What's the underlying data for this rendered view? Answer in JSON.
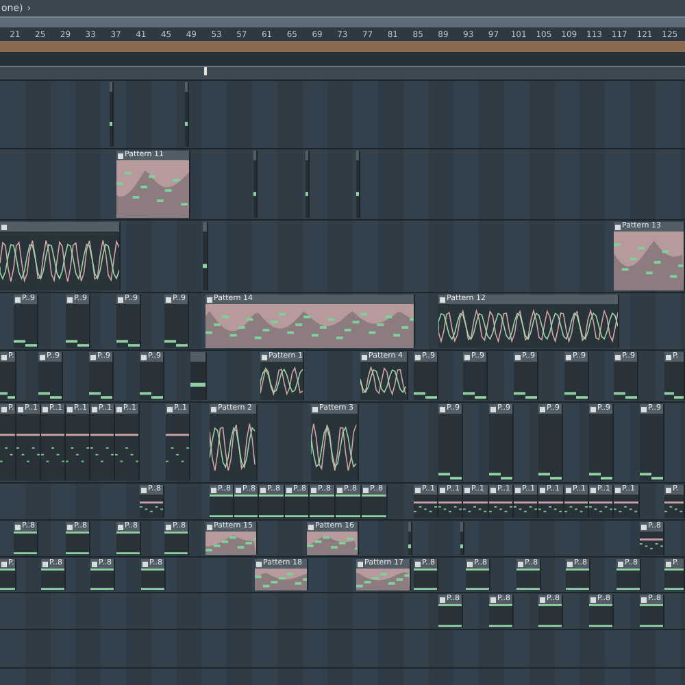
{
  "header": {
    "title": "one)",
    "arrow": "›"
  },
  "ruler": [
    "21",
    "25",
    "29",
    "33",
    "37",
    "41",
    "45",
    "49",
    "53",
    "57",
    "61",
    "65",
    "69",
    "73",
    "77",
    "81",
    "85",
    "89",
    "93",
    "97",
    "101",
    "105",
    "109",
    "113",
    "117",
    "121",
    "125"
  ],
  "tracks": [
    {
      "clips": [
        {
          "kind": "sliver"
        },
        {
          "kind": "sliver"
        }
      ]
    },
    {
      "clips": [
        {
          "kind": "melody",
          "label": "Pattern 11"
        },
        {
          "kind": "sliver"
        },
        {
          "kind": "sliver"
        },
        {
          "kind": "sliver"
        }
      ]
    },
    {
      "clips": [
        {
          "kind": "wave"
        },
        {
          "kind": "sliver"
        },
        {
          "kind": "melody",
          "label": "Pattern 13"
        }
      ]
    },
    {
      "clips": [
        {
          "kind": "steps",
          "label": "P..9"
        },
        {
          "kind": "steps",
          "label": "P..9"
        },
        {
          "kind": "steps",
          "label": "P..9"
        },
        {
          "kind": "steps",
          "label": "P..9"
        },
        {
          "kind": "melody",
          "label": "Pattern 14"
        },
        {
          "kind": "wave",
          "label": "Pattern 12"
        }
      ]
    },
    {
      "clips": [
        {
          "kind": "steps",
          "label": "P."
        },
        {
          "kind": "steps",
          "label": "P..9"
        },
        {
          "kind": "steps",
          "label": "P..9"
        },
        {
          "kind": "steps",
          "label": "P..9"
        },
        {
          "kind": "sliver"
        },
        {
          "kind": "wave",
          "label": "Pattern 1"
        },
        {
          "kind": "wave",
          "label": "Pattern 4"
        },
        {
          "kind": "steps",
          "label": "P..9"
        },
        {
          "kind": "steps",
          "label": "P..9"
        },
        {
          "kind": "steps",
          "label": "P..9"
        },
        {
          "kind": "steps",
          "label": "P..9"
        },
        {
          "kind": "steps",
          "label": "P..9"
        },
        {
          "kind": "steps",
          "label": "P."
        }
      ]
    },
    {
      "clips": [
        {
          "kind": "dots",
          "label": "P."
        },
        {
          "kind": "dots",
          "label": "P..1"
        },
        {
          "kind": "dots",
          "label": "P..1"
        },
        {
          "kind": "dots",
          "label": "P..1"
        },
        {
          "kind": "dots",
          "label": "P..1"
        },
        {
          "kind": "dots",
          "label": "P..1"
        },
        {
          "kind": "dots",
          "label": "P..1"
        },
        {
          "kind": "wave",
          "label": "Pattern 2"
        },
        {
          "kind": "wave",
          "label": "Pattern 3"
        },
        {
          "kind": "steps",
          "label": "P..9"
        },
        {
          "kind": "steps",
          "label": "P..9"
        },
        {
          "kind": "steps",
          "label": "P..9"
        },
        {
          "kind": "steps",
          "label": "P..9"
        },
        {
          "kind": "steps",
          "label": "P..9"
        }
      ]
    },
    {
      "clips": [
        {
          "kind": "dots",
          "label": "P..8"
        },
        {
          "kind": "bars",
          "label": "P..8"
        },
        {
          "kind": "bars",
          "label": "P..8"
        },
        {
          "kind": "bars",
          "label": "P..8"
        },
        {
          "kind": "bars",
          "label": "P..8"
        },
        {
          "kind": "bars",
          "label": "P..8"
        },
        {
          "kind": "bars",
          "label": "P..8"
        },
        {
          "kind": "bars",
          "label": "P..8"
        },
        {
          "kind": "dots",
          "label": "P..1"
        },
        {
          "kind": "dots",
          "label": "P..1"
        },
        {
          "kind": "dots",
          "label": "P..1"
        },
        {
          "kind": "dots",
          "label": "P..1"
        },
        {
          "kind": "dots",
          "label": "P..1"
        },
        {
          "kind": "dots",
          "label": "P..1"
        },
        {
          "kind": "dots",
          "label": "P..1"
        },
        {
          "kind": "dots",
          "label": "P..1"
        },
        {
          "kind": "dots",
          "label": "P..1"
        },
        {
          "kind": "dots",
          "label": "P."
        }
      ]
    },
    {
      "clips": [
        {
          "kind": "bars",
          "label": "P..8"
        },
        {
          "kind": "bars",
          "label": "P..8"
        },
        {
          "kind": "bars",
          "label": "P..8"
        },
        {
          "kind": "bars",
          "label": "P..8"
        },
        {
          "kind": "melody",
          "label": "Pattern 15"
        },
        {
          "kind": "melody",
          "label": "Pattern 16"
        },
        {
          "kind": "sliver"
        },
        {
          "kind": "sliver"
        },
        {
          "kind": "dots",
          "label": "P..8"
        }
      ]
    },
    {
      "clips": [
        {
          "kind": "bars",
          "label": "P."
        },
        {
          "kind": "bars",
          "label": "P..8"
        },
        {
          "kind": "bars",
          "label": "P..8"
        },
        {
          "kind": "bars",
          "label": "P..8"
        },
        {
          "kind": "melody",
          "label": "Pattern 18"
        },
        {
          "kind": "melody",
          "label": "Pattern 17"
        },
        {
          "kind": "bars",
          "label": "P..8"
        },
        {
          "kind": "bars",
          "label": "P..8"
        },
        {
          "kind": "bars",
          "label": "P..8"
        },
        {
          "kind": "bars",
          "label": "P..8"
        },
        {
          "kind": "bars",
          "label": "P..8"
        },
        {
          "kind": "bars",
          "label": "P."
        }
      ]
    },
    {
      "clips": [
        {
          "kind": "bars",
          "label": "P..8"
        },
        {
          "kind": "bars",
          "label": "P..8"
        },
        {
          "kind": "bars",
          "label": "P..8"
        },
        {
          "kind": "bars",
          "label": "P..8"
        },
        {
          "kind": "bars",
          "label": "P..8"
        }
      ]
    }
  ]
}
